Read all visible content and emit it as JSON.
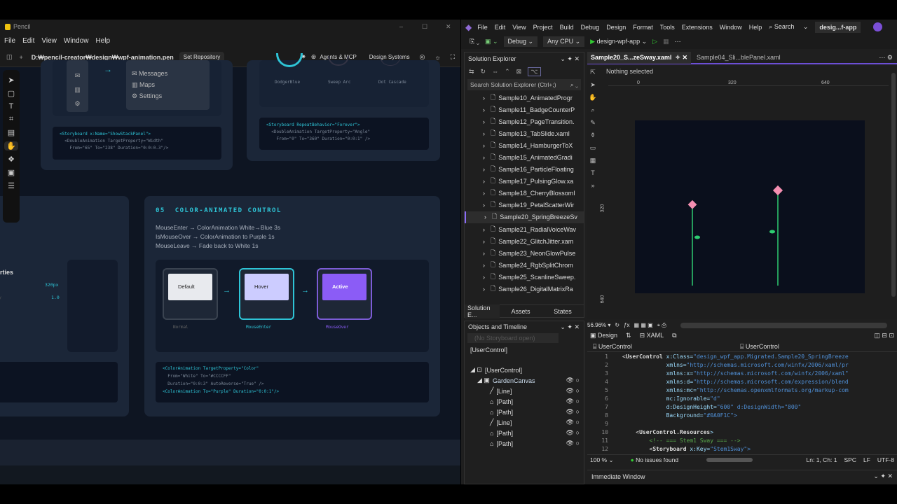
{
  "pencil": {
    "app_title": "Pencil",
    "menu": [
      "File",
      "Edit",
      "View",
      "Window",
      "Help"
    ],
    "file_path": "D:₩pencil-creator₩design₩wpf-animation.pen",
    "set_repository": "Set Repository",
    "agents": "Agents & MCP",
    "design_systems": "Design Systems",
    "card_a": {
      "menu_items": [
        "Messages",
        "Maps",
        "Settings"
      ],
      "code": [
        "<Storyboard x:Name=\"ShowStackPanel\">",
        "  <DoubleAnimation TargetProperty=\"Width\"",
        "    From=\"65\" To=\"238\" Duration=\"0:0:0.3\"/>"
      ]
    },
    "card_b": {
      "labels": [
        "DodgerBlue",
        "Sweep Arc",
        "Dot Cascade"
      ],
      "code": [
        "<Storyboard RepeatBehavior=\"Forever\">",
        "  <DoubleAnimation TargetProperty=\"Angle\"",
        "    From=\"0\" To=\"360\" Duration=\"0:0:1\" />"
      ]
    },
    "card_c": {
      "heading": "rties",
      "prop1": "320px",
      "prop2_label": "y",
      "prop2": "1.0"
    },
    "card_d": {
      "number": "05",
      "title": "COLOR-ANIMATED CONTROL",
      "desc": [
        "MouseEnter → ColorAnimation White→Blue 3s",
        "IsMouseOver → ColorAnimation to Purple 1s",
        "MouseLeave → Fade back to White 1s"
      ],
      "states": [
        {
          "button": "Default",
          "label": "Normal"
        },
        {
          "button": "Hover",
          "label": "MouseEnter"
        },
        {
          "button": "Active",
          "label": "MouseOver"
        }
      ],
      "code": [
        "<ColorAnimation TargetProperty=\"Color\"",
        "  From=\"White\" To=\"#CCCCFF\"",
        "  Duration=\"0:0:3\" AutoReverse=\"True\" />",
        "<ColorAnimation To=\"Purple\" Duration=\"0:0:1\"/>"
      ]
    }
  },
  "vs": {
    "menu": [
      "File",
      "Edit",
      "View",
      "Project",
      "Build",
      "Debug",
      "Design",
      "Format",
      "Tools",
      "Extensions",
      "Window",
      "Help"
    ],
    "search": "Search",
    "solution_name": "desig...f-app",
    "config": "Debug",
    "platform": "Any CPU",
    "run_target": "design-wpf-app",
    "solution_explorer": "Solution Explorer",
    "search_placeholder": "Search Solution Explorer (Ctrl+;)",
    "files": [
      "Sample10_AnimatedProgr",
      "Sample11_BadgeCounterP",
      "Sample12_PageTransition.",
      "Sample13_TabSlide.xaml",
      "Sample14_HamburgerToX",
      "Sample15_AnimatedGradi",
      "Sample16_ParticleFloating",
      "Sample17_PulsingGlow.xa",
      "Sample18_CherryBlossomI",
      "Sample19_PetalScatterWir",
      "Sample20_SpringBreezeSv",
      "Sample21_RadialVoiceWav",
      "Sample22_GlitchJitter.xam",
      "Sample23_NeonGlowPulse",
      "Sample24_RgbSplitChrom",
      "Sample25_ScanlineSweep.",
      "Sample26_DigitalMatrixRa"
    ],
    "bottom_tabs": [
      "Solution E...",
      "Assets",
      "States"
    ],
    "objects_title": "Objects and Timeline",
    "storyboard_placeholder": "(No Storyboard open)",
    "root": "[UserControl]",
    "tree": [
      "[UserControl]",
      "GardenCanvas",
      "[Line]",
      "[Path]",
      "[Path]",
      "[Line]",
      "[Path]",
      "[Path]"
    ],
    "tabs": [
      "Sample20_S...zeSway.xaml",
      "Sample04_Sli...blePanel.xaml"
    ],
    "nothing_selected": "Nothing selected",
    "ruler": [
      "0",
      "320",
      "640"
    ],
    "ruler_v": [
      "320",
      "640"
    ],
    "zoom": "56.96%",
    "design_tab": "Design",
    "xaml_tab": "XAML",
    "scope_left": "UserControl",
    "scope_right": "UserControl",
    "code_lines": [
      [
        "<",
        "UserControl",
        " x:Class=",
        "\"design_wpf_app.Migrated.Sample20_SpringBreeze"
      ],
      [
        "",
        "",
        "             xmlns=",
        "\"http://schemas.microsoft.com/winfx/2006/xaml/pr"
      ],
      [
        "",
        "",
        "             xmlns:x=",
        "\"http://schemas.microsoft.com/winfx/2006/xaml\""
      ],
      [
        "",
        "",
        "             xmlns:d=",
        "\"http://schemas.microsoft.com/expression/blend"
      ],
      [
        "",
        "",
        "             xmlns:mc=",
        "\"http://schemas.openxmlformats.org/markup-com"
      ],
      [
        "",
        "",
        "             mc:Ignorable=",
        "\"d\""
      ],
      [
        "",
        "",
        "             d:DesignHeight=",
        "\"600\" d:DesignWidth=\"800\""
      ],
      [
        "",
        "",
        "             Background=",
        "\"#0A0F1C\">"
      ],
      [
        "",
        "",
        "",
        ""
      ],
      [
        "    <",
        "UserControl.Resources",
        ">",
        ""
      ],
      [
        "",
        "",
        "        <!-- === Stem1 Sway === -->",
        ""
      ],
      [
        "        <",
        "Storyboard",
        " x:Key=",
        "\"Stem1Sway\">"
      ]
    ],
    "editor_zoom": "100 %",
    "issues": "No issues found",
    "position": "Ln: 1, Ch: 1",
    "spc": "SPC",
    "lf": "LF",
    "enc": "UTF-8",
    "immediate": "Immediate Window"
  },
  "colors": {
    "accent_cyan": "#2ec4d6",
    "purple": "#8b5cf6",
    "hover": "#ccccff",
    "artboard": "#0a0f1c",
    "stem": "#2ecc71",
    "petal": "#f48fb1"
  }
}
